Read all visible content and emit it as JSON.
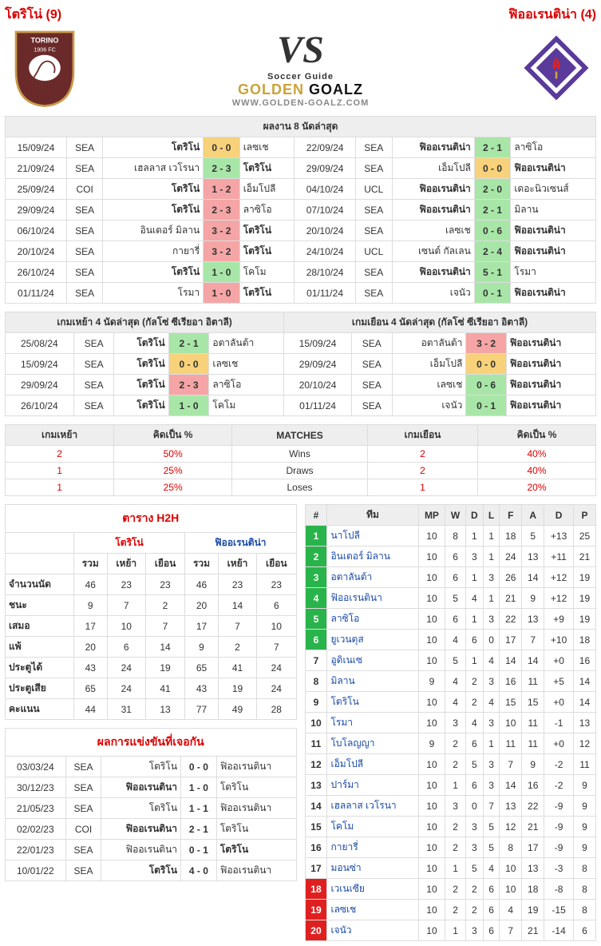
{
  "header": {
    "home_title": "โตริโน่ (9)",
    "away_title": "ฟิออเรนติน่า (4)",
    "vs": "VS",
    "brand_a": "GOLDEN",
    "brand_b": " GOALZ",
    "brand_sub": "Soccer Guide",
    "brand_url": "WWW.GOLDEN-GOALZ.COM",
    "home_badge": "TORINO FC 1906",
    "away_badge": "ACF"
  },
  "sections": {
    "last8": "ผลงาน 8 นัดล่าสุด",
    "home_last4": "เกมเหย้า 4 นัดล่าสุด (กัลโซ่ ซีเรียอา อิตาลี)",
    "away_last4": "เกมเยือน 4 นัดล่าสุด (กัลโซ่ ซีเรียอา อิตาลี)",
    "h2h_title": "ตาราง H2H",
    "vs_title": "ผลการแข่งขันที่เจอกัน"
  },
  "last8_home": [
    {
      "date": "15/09/24",
      "comp": "SEA",
      "home": "โตริโน่",
      "hb": true,
      "score": "0 - 0",
      "cls": "amber",
      "away": "เลซเช"
    },
    {
      "date": "21/09/24",
      "comp": "SEA",
      "home": "เฮลลาส เวโรนา",
      "score": "2 - 3",
      "cls": "green",
      "away": "โตริโน่",
      "ab": true
    },
    {
      "date": "25/09/24",
      "comp": "COI",
      "home": "โตริโน่",
      "hb": true,
      "score": "1 - 2",
      "cls": "red",
      "away": "เอ็มโปลี"
    },
    {
      "date": "29/09/24",
      "comp": "SEA",
      "home": "โตริโน่",
      "hb": true,
      "score": "2 - 3",
      "cls": "red",
      "away": "ลาซิโอ"
    },
    {
      "date": "06/10/24",
      "comp": "SEA",
      "home": "อินเตอร์ มิลาน",
      "score": "3 - 2",
      "cls": "red",
      "away": "โตริโน่",
      "ab": true
    },
    {
      "date": "20/10/24",
      "comp": "SEA",
      "home": "กายารี่",
      "score": "3 - 2",
      "cls": "red",
      "away": "โตริโน่",
      "ab": true
    },
    {
      "date": "26/10/24",
      "comp": "SEA",
      "home": "โตริโน่",
      "hb": true,
      "score": "1 - 0",
      "cls": "green",
      "away": "โคโม"
    },
    {
      "date": "01/11/24",
      "comp": "SEA",
      "home": "โรมา",
      "score": "1 - 0",
      "cls": "red",
      "away": "โตริโน่",
      "ab": true
    }
  ],
  "last8_away": [
    {
      "date": "22/09/24",
      "comp": "SEA",
      "home": "ฟิออเรนติน่า",
      "hb": true,
      "score": "2 - 1",
      "cls": "green",
      "away": "ลาซิโอ"
    },
    {
      "date": "29/09/24",
      "comp": "SEA",
      "home": "เอ็มโปลี",
      "score": "0 - 0",
      "cls": "amber",
      "away": "ฟิออเรนติน่า",
      "ab": true
    },
    {
      "date": "04/10/24",
      "comp": "UCL",
      "home": "ฟิออเรนติน่า",
      "hb": true,
      "score": "2 - 0",
      "cls": "green",
      "away": "เดอะนิวเซนส์"
    },
    {
      "date": "07/10/24",
      "comp": "SEA",
      "home": "ฟิออเรนติน่า",
      "hb": true,
      "score": "2 - 1",
      "cls": "green",
      "away": "มิลาน"
    },
    {
      "date": "20/10/24",
      "comp": "SEA",
      "home": "เลซเช",
      "score": "0 - 6",
      "cls": "green",
      "away": "ฟิออเรนติน่า",
      "ab": true
    },
    {
      "date": "24/10/24",
      "comp": "UCL",
      "home": "เซนต์ กัลเลน",
      "score": "2 - 4",
      "cls": "green",
      "away": "ฟิออเรนติน่า",
      "ab": true
    },
    {
      "date": "28/10/24",
      "comp": "SEA",
      "home": "ฟิออเรนติน่า",
      "hb": true,
      "score": "5 - 1",
      "cls": "green",
      "away": "โรมา"
    },
    {
      "date": "01/11/24",
      "comp": "SEA",
      "home": "เจนัว",
      "score": "0 - 1",
      "cls": "green",
      "away": "ฟิออเรนติน่า",
      "ab": true
    }
  ],
  "home4": [
    {
      "date": "25/08/24",
      "comp": "SEA",
      "home": "โตริโน่",
      "score": "2 - 1",
      "cls": "green",
      "away": "อตาลันต้า"
    },
    {
      "date": "15/09/24",
      "comp": "SEA",
      "home": "โตริโน่",
      "score": "0 - 0",
      "cls": "amber",
      "away": "เลซเช"
    },
    {
      "date": "29/09/24",
      "comp": "SEA",
      "home": "โตริโน่",
      "score": "2 - 3",
      "cls": "red",
      "away": "ลาซิโอ"
    },
    {
      "date": "26/10/24",
      "comp": "SEA",
      "home": "โตริโน่",
      "score": "1 - 0",
      "cls": "green",
      "away": "โคโม"
    }
  ],
  "away4": [
    {
      "date": "15/09/24",
      "comp": "SEA",
      "home": "อตาลันต้า",
      "score": "3 - 2",
      "cls": "red",
      "away": "ฟิออเรนติน่า"
    },
    {
      "date": "29/09/24",
      "comp": "SEA",
      "home": "เอ็มโปลี",
      "score": "0 - 0",
      "cls": "amber",
      "away": "ฟิออเรนติน่า"
    },
    {
      "date": "20/10/24",
      "comp": "SEA",
      "home": "เลซเช",
      "score": "0 - 6",
      "cls": "green",
      "away": "ฟิออเรนติน่า"
    },
    {
      "date": "01/11/24",
      "comp": "SEA",
      "home": "เจนัว",
      "score": "0 - 1",
      "cls": "green",
      "away": "ฟิออเรนติน่า"
    }
  ],
  "wld": {
    "cols": [
      "เกมเหย้า",
      "คิดเป็น %",
      "MATCHES",
      "เกมเยือน",
      "คิดเป็น %"
    ],
    "rows": [
      {
        "hv": "2",
        "hp": "50%",
        "lbl": "Wins",
        "av": "2",
        "ap": "40%"
      },
      {
        "hv": "1",
        "hp": "25%",
        "lbl": "Draws",
        "av": "2",
        "ap": "40%"
      },
      {
        "hv": "1",
        "hp": "25%",
        "lbl": "Loses",
        "av": "1",
        "ap": "20%"
      }
    ]
  },
  "h2h": {
    "team_home": "โตริโน่",
    "team_away": "ฟิออเรนติน่า",
    "sub": [
      "รวม",
      "เหย้า",
      "เยือน",
      "รวม",
      "เหย้า",
      "เยือน"
    ],
    "rows": [
      {
        "lbl": "จำนวนนัด",
        "v": [
          "46",
          "23",
          "23",
          "46",
          "23",
          "23"
        ]
      },
      {
        "lbl": "ชนะ",
        "v": [
          "9",
          "7",
          "2",
          "20",
          "14",
          "6"
        ]
      },
      {
        "lbl": "เสมอ",
        "v": [
          "17",
          "10",
          "7",
          "17",
          "7",
          "10"
        ]
      },
      {
        "lbl": "แพ้",
        "v": [
          "20",
          "6",
          "14",
          "9",
          "2",
          "7"
        ]
      },
      {
        "lbl": "ประตูได้",
        "v": [
          "43",
          "24",
          "19",
          "65",
          "41",
          "24"
        ]
      },
      {
        "lbl": "ประตูเสีย",
        "v": [
          "65",
          "24",
          "41",
          "43",
          "19",
          "24"
        ]
      },
      {
        "lbl": "คะแนน",
        "v": [
          "44",
          "31",
          "13",
          "77",
          "49",
          "28"
        ]
      }
    ]
  },
  "meetings": [
    {
      "date": "03/03/24",
      "comp": "SEA",
      "home": "โตริโน",
      "score": "0 - 0",
      "cls": "",
      "away": "ฟิออเรนตินา"
    },
    {
      "date": "30/12/23",
      "comp": "SEA",
      "home": "ฟิออเรนตินา",
      "hb": true,
      "score": "1 - 0",
      "cls": "",
      "away": "โตริโน"
    },
    {
      "date": "21/05/23",
      "comp": "SEA",
      "home": "โตริโน",
      "score": "1 - 1",
      "cls": "",
      "away": "ฟิออเรนตินา"
    },
    {
      "date": "02/02/23",
      "comp": "COI",
      "home": "ฟิออเรนตินา",
      "hb": true,
      "score": "2 - 1",
      "cls": "",
      "away": "โตริโน"
    },
    {
      "date": "22/01/23",
      "comp": "SEA",
      "home": "ฟิออเรนตินา",
      "score": "0 - 1",
      "cls": "",
      "away": "โตริโน",
      "ab": true
    },
    {
      "date": "10/01/22",
      "comp": "SEA",
      "home": "โตริโน",
      "hb": true,
      "score": "4 - 0",
      "cls": "",
      "away": "ฟิออเรนตินา"
    }
  ],
  "standings": {
    "cols": [
      "#",
      "ทีม",
      "MP",
      "W",
      "D",
      "L",
      "F",
      "A",
      "D",
      "P"
    ],
    "rows": [
      {
        "p": "1",
        "pc": "pos-green",
        "t": "นาโปลี",
        "v": [
          "10",
          "8",
          "1",
          "1",
          "18",
          "5",
          "+13",
          "25"
        ]
      },
      {
        "p": "2",
        "pc": "pos-green",
        "t": "อินเตอร์ มิลาน",
        "v": [
          "10",
          "6",
          "3",
          "1",
          "24",
          "13",
          "+11",
          "21"
        ]
      },
      {
        "p": "3",
        "pc": "pos-green",
        "t": "อตาลันต้า",
        "v": [
          "10",
          "6",
          "1",
          "3",
          "26",
          "14",
          "+12",
          "19"
        ]
      },
      {
        "p": "4",
        "pc": "pos-green",
        "t": "ฟิออเรนตินา",
        "v": [
          "10",
          "5",
          "4",
          "1",
          "21",
          "9",
          "+12",
          "19"
        ]
      },
      {
        "p": "5",
        "pc": "pos-green",
        "t": "ลาซิโอ",
        "v": [
          "10",
          "6",
          "1",
          "3",
          "22",
          "13",
          "+9",
          "19"
        ]
      },
      {
        "p": "6",
        "pc": "pos-green",
        "t": "ยูเวนตุส",
        "v": [
          "10",
          "4",
          "6",
          "0",
          "17",
          "7",
          "+10",
          "18"
        ]
      },
      {
        "p": "7",
        "pc": "",
        "t": "อูดิเนเซ",
        "v": [
          "10",
          "5",
          "1",
          "4",
          "14",
          "14",
          "+0",
          "16"
        ]
      },
      {
        "p": "8",
        "pc": "",
        "t": "มิลาน",
        "v": [
          "9",
          "4",
          "2",
          "3",
          "16",
          "11",
          "+5",
          "14"
        ]
      },
      {
        "p": "9",
        "pc": "",
        "t": "โตริโน",
        "v": [
          "10",
          "4",
          "2",
          "4",
          "15",
          "15",
          "+0",
          "14"
        ]
      },
      {
        "p": "10",
        "pc": "",
        "t": "โรมา",
        "v": [
          "10",
          "3",
          "4",
          "3",
          "10",
          "11",
          "-1",
          "13"
        ]
      },
      {
        "p": "11",
        "pc": "",
        "t": "โบโลญญา",
        "v": [
          "9",
          "2",
          "6",
          "1",
          "11",
          "11",
          "+0",
          "12"
        ]
      },
      {
        "p": "12",
        "pc": "",
        "t": "เอ็มโปลี",
        "v": [
          "10",
          "2",
          "5",
          "3",
          "7",
          "9",
          "-2",
          "11"
        ]
      },
      {
        "p": "13",
        "pc": "",
        "t": "ปาร์มา",
        "v": [
          "10",
          "1",
          "6",
          "3",
          "14",
          "16",
          "-2",
          "9"
        ]
      },
      {
        "p": "14",
        "pc": "",
        "t": "เฮลลาส เวโรนา",
        "v": [
          "10",
          "3",
          "0",
          "7",
          "13",
          "22",
          "-9",
          "9"
        ]
      },
      {
        "p": "15",
        "pc": "",
        "t": "โคโม",
        "v": [
          "10",
          "2",
          "3",
          "5",
          "12",
          "21",
          "-9",
          "9"
        ]
      },
      {
        "p": "16",
        "pc": "",
        "t": "กายารี่",
        "v": [
          "10",
          "2",
          "3",
          "5",
          "8",
          "17",
          "-9",
          "9"
        ]
      },
      {
        "p": "17",
        "pc": "",
        "t": "มอนซ่า",
        "v": [
          "10",
          "1",
          "5",
          "4",
          "10",
          "13",
          "-3",
          "8"
        ]
      },
      {
        "p": "18",
        "pc": "pos-red",
        "t": "เวเนเซีย",
        "v": [
          "10",
          "2",
          "2",
          "6",
          "10",
          "18",
          "-8",
          "8"
        ]
      },
      {
        "p": "19",
        "pc": "pos-red",
        "t": "เลซเช",
        "v": [
          "10",
          "2",
          "2",
          "6",
          "4",
          "19",
          "-15",
          "8"
        ]
      },
      {
        "p": "20",
        "pc": "pos-red",
        "t": "เจนัว",
        "v": [
          "10",
          "1",
          "3",
          "6",
          "7",
          "21",
          "-14",
          "6"
        ]
      }
    ]
  }
}
